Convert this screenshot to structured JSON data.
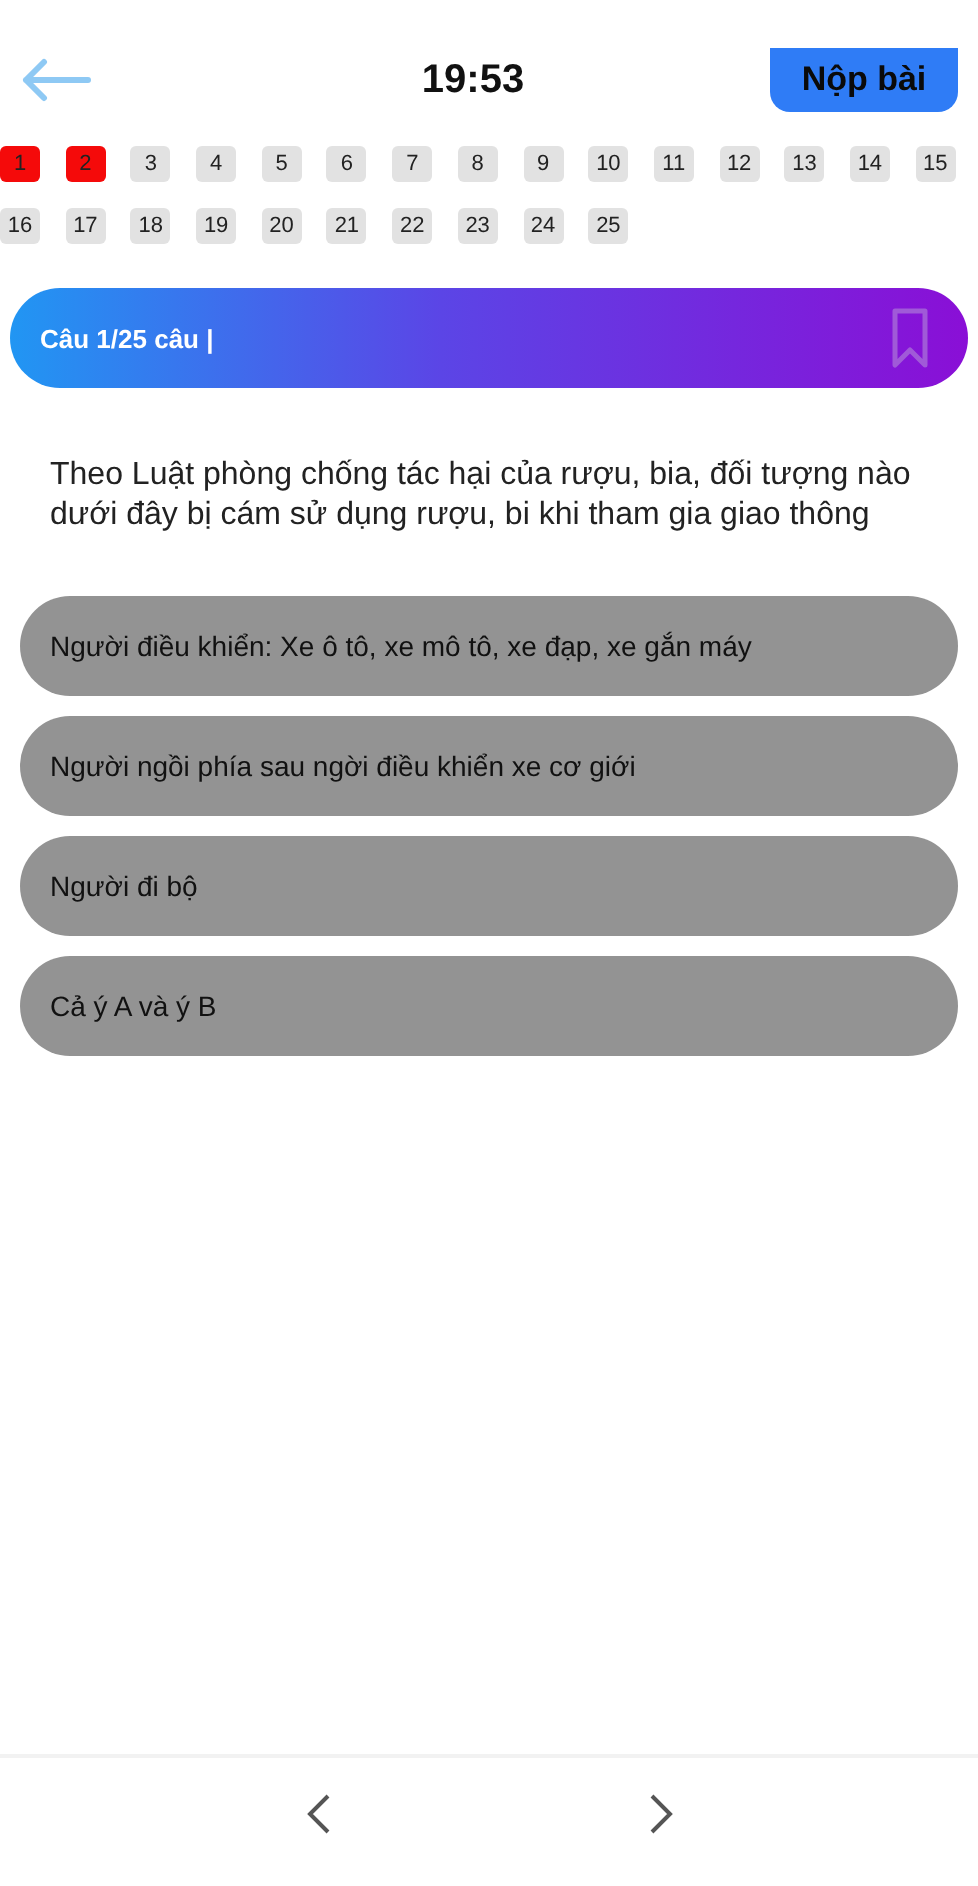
{
  "header": {
    "time": "19:53",
    "submit_button": "Nộp bài"
  },
  "question_numbers": [
    {
      "label": "1",
      "answered": true
    },
    {
      "label": "2",
      "answered": true
    },
    {
      "label": "3",
      "answered": false
    },
    {
      "label": "4",
      "answered": false
    },
    {
      "label": "5",
      "answered": false
    },
    {
      "label": "6",
      "answered": false
    },
    {
      "label": "7",
      "answered": false
    },
    {
      "label": "8",
      "answered": false
    },
    {
      "label": "9",
      "answered": false
    },
    {
      "label": "10",
      "answered": false
    },
    {
      "label": "11",
      "answered": false
    },
    {
      "label": "12",
      "answered": false
    },
    {
      "label": "13",
      "answered": false
    },
    {
      "label": "14",
      "answered": false
    },
    {
      "label": "15",
      "answered": false
    },
    {
      "label": "16",
      "answered": false
    },
    {
      "label": "17",
      "answered": false
    },
    {
      "label": "18",
      "answered": false
    },
    {
      "label": "19",
      "answered": false
    },
    {
      "label": "20",
      "answered": false
    },
    {
      "label": "21",
      "answered": false
    },
    {
      "label": "22",
      "answered": false
    },
    {
      "label": "23",
      "answered": false
    },
    {
      "label": "24",
      "answered": false
    },
    {
      "label": "25",
      "answered": false
    }
  ],
  "question_banner": {
    "counter": "Câu 1/25 câu |",
    "bookmarked": false
  },
  "question": "Theo Luật phòng chống tác hại của rượu, bia, đối tượng nào dưới đây bị cám sử dụng rượu, bi khi tham gia giao thông",
  "answers": [
    {
      "text": "Người điều khiển: Xe ô tô, xe mô tô, xe đạp, xe gắn máy",
      "selected": false
    },
    {
      "text": "Người ngồi phía sau ngời điều khiển xe cơ giới",
      "selected": false
    },
    {
      "text": "Người đi bộ",
      "selected": false
    },
    {
      "text": "Cả ý A và ý B",
      "selected": false
    }
  ]
}
